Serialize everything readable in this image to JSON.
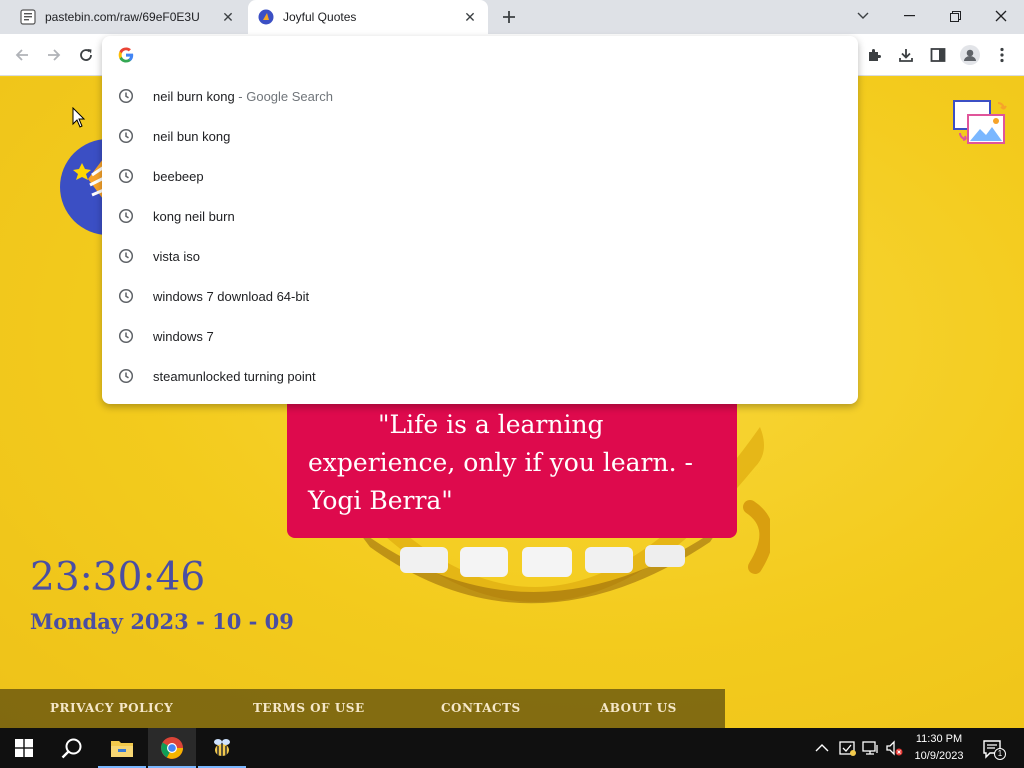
{
  "browser": {
    "tabs": [
      {
        "title": "pastebin.com/raw/69eF0E3U",
        "active": false
      },
      {
        "title": "Joyful Quotes",
        "active": true
      }
    ]
  },
  "omnibox": {
    "value": "",
    "suggestions": [
      {
        "text": "neil burn kong",
        "suffix": " - Google Search"
      },
      {
        "text": "neil bun kong",
        "suffix": ""
      },
      {
        "text": "beebeep",
        "suffix": ""
      },
      {
        "text": "kong neil burn",
        "suffix": ""
      },
      {
        "text": "vista iso",
        "suffix": ""
      },
      {
        "text": "windows 7 download 64-bit",
        "suffix": ""
      },
      {
        "text": "windows 7",
        "suffix": ""
      },
      {
        "text": "steamunlocked turning point",
        "suffix": ""
      }
    ]
  },
  "page": {
    "quote": "\"Life is a learning experience, only if you learn. - Yogi Berra\"",
    "clock": "23:30:46",
    "date": "Monday 2023 - 10 - 09",
    "footer": [
      "PRIVACY POLICY",
      "TERMS OF USE",
      "CONTACTS",
      "ABOUT US"
    ]
  },
  "taskbar": {
    "time": "11:30 PM",
    "date": "10/9/2023",
    "notification_count": "1"
  },
  "colors": {
    "quote_bg": "#de0a4d",
    "clock_text": "#4a4ea3",
    "page_bg": "#f3cd1e"
  }
}
